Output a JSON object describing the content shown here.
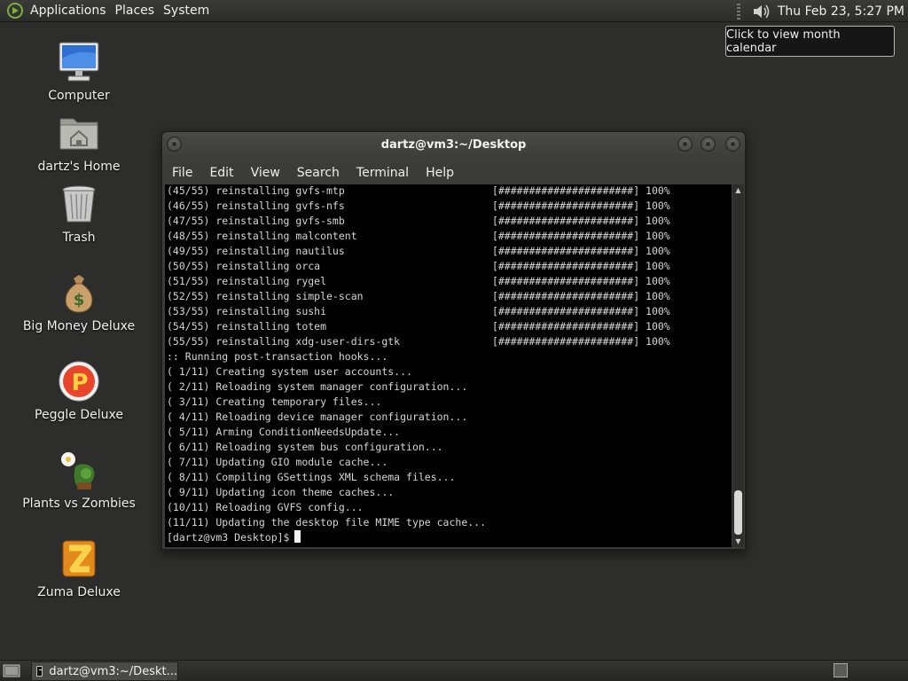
{
  "top_panel": {
    "menus": [
      "Applications",
      "Places",
      "System"
    ],
    "clock": "Thu Feb 23,  5:27 PM",
    "tooltip": "Click to view month calendar"
  },
  "desktop": {
    "icons": [
      {
        "label": "Computer",
        "icon": "computer-icon"
      },
      {
        "label": "dartz's Home",
        "icon": "home-folder-icon"
      },
      {
        "label": "Trash",
        "icon": "trash-icon"
      },
      {
        "label": "Big Money Deluxe",
        "icon": "money-bag-icon"
      },
      {
        "label": "Peggle Deluxe",
        "icon": "peggle-icon"
      },
      {
        "label": "Plants vs Zombies",
        "icon": "plants-vs-zombies-icon"
      },
      {
        "label": "Zuma Deluxe",
        "icon": "zuma-icon"
      }
    ]
  },
  "terminal": {
    "title": "dartz@vm3:~/Desktop",
    "menus": [
      "File",
      "Edit",
      "View",
      "Search",
      "Terminal",
      "Help"
    ],
    "lines": [
      "(45/55) reinstalling gvfs-mtp                        [######################] 100%",
      "(46/55) reinstalling gvfs-nfs                        [######################] 100%",
      "(47/55) reinstalling gvfs-smb                        [######################] 100%",
      "(48/55) reinstalling malcontent                      [######################] 100%",
      "(49/55) reinstalling nautilus                        [######################] 100%",
      "(50/55) reinstalling orca                            [######################] 100%",
      "(51/55) reinstalling rygel                           [######################] 100%",
      "(52/55) reinstalling simple-scan                     [######################] 100%",
      "(53/55) reinstalling sushi                           [######################] 100%",
      "(54/55) reinstalling totem                           [######################] 100%",
      "(55/55) reinstalling xdg-user-dirs-gtk               [######################] 100%",
      ":: Running post-transaction hooks...",
      "( 1/11) Creating system user accounts...",
      "( 2/11) Reloading system manager configuration...",
      "( 3/11) Creating temporary files...",
      "( 4/11) Reloading device manager configuration...",
      "( 5/11) Arming ConditionNeedsUpdate...",
      "( 6/11) Reloading system bus configuration...",
      "( 7/11) Updating GIO module cache...",
      "( 8/11) Compiling GSettings XML schema files...",
      "( 9/11) Updating icon theme caches...",
      "(10/11) Reloading GVFS config...",
      "(11/11) Updating the desktop file MIME type cache..."
    ],
    "prompt": "[dartz@vm3 Desktop]$"
  },
  "taskbar": {
    "window_button": "dartz@vm3:~/Deskt..."
  }
}
